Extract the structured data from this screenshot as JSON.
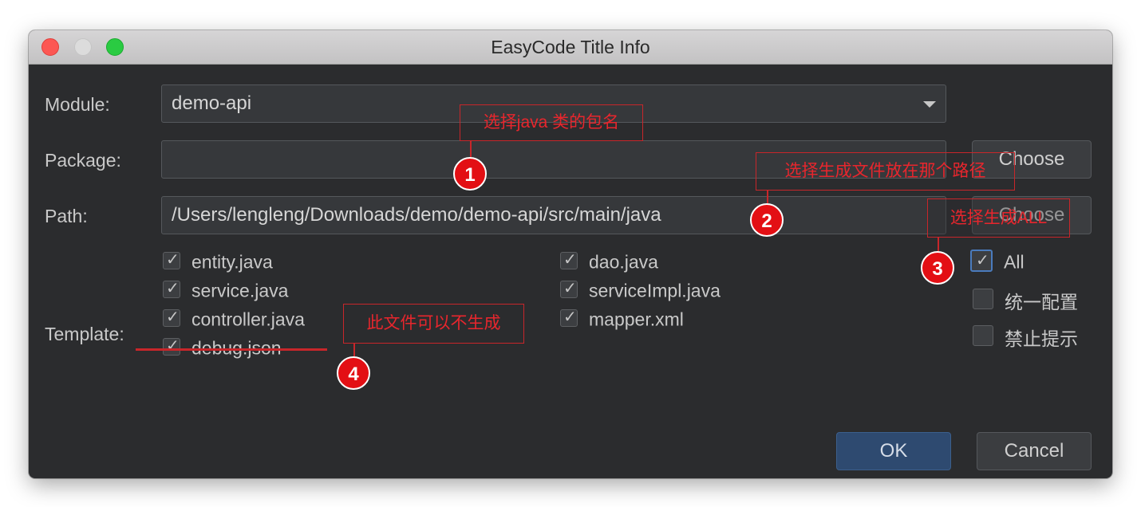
{
  "window": {
    "title": "EasyCode Title Info"
  },
  "module": {
    "label": "Module:",
    "value": "demo-api"
  },
  "package": {
    "label": "Package:",
    "value": "",
    "choose_label": "Choose"
  },
  "path": {
    "label": "Path:",
    "value": "/Users/lengleng/Downloads/demo/demo-api/src/main/java",
    "choose_label": "Choose"
  },
  "template": {
    "label": "Template:",
    "left": [
      {
        "label": "entity.java",
        "checked": true
      },
      {
        "label": "service.java",
        "checked": true
      },
      {
        "label": "controller.java",
        "checked": true
      },
      {
        "label": "debug.json",
        "checked": true
      }
    ],
    "right": [
      {
        "label": "dao.java",
        "checked": true
      },
      {
        "label": "serviceImpl.java",
        "checked": true
      },
      {
        "label": "mapper.xml",
        "checked": true
      }
    ]
  },
  "options": {
    "all": {
      "label": "All",
      "checked": true
    },
    "unified_config": {
      "label": "统一配置",
      "checked": false
    },
    "disable_prompt": {
      "label": "禁止提示",
      "checked": false
    }
  },
  "buttons": {
    "ok": "OK",
    "cancel": "Cancel"
  },
  "annotations": {
    "a1": {
      "num": "1",
      "text": "选择java 类的包名"
    },
    "a2": {
      "num": "2",
      "text": "选择生成文件放在那个路径"
    },
    "a3": {
      "num": "3",
      "text": "选择生成ALL"
    },
    "a4": {
      "num": "4",
      "text": "此文件可以不生成"
    }
  },
  "colors": {
    "dialog_bg": "#2b2c2e",
    "annotation_red": "#e30f14",
    "ok_button": "#2e4a70"
  }
}
